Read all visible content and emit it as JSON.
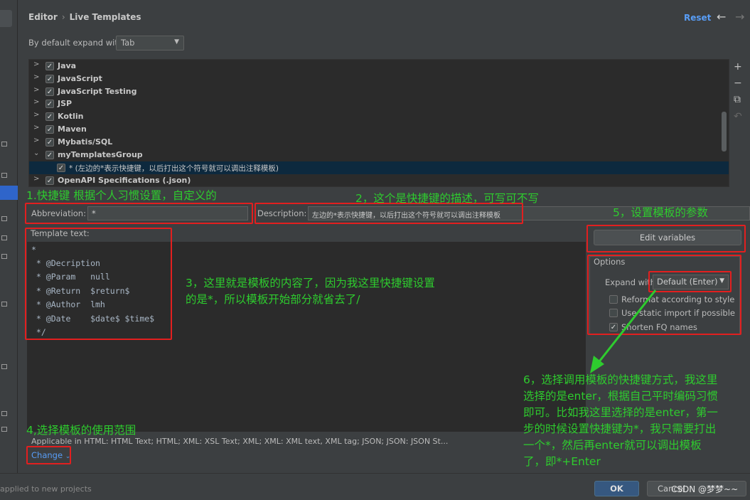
{
  "header": {
    "breadcrumb_parent": "Editor",
    "breadcrumb_current": "Live Templates",
    "reset": "Reset",
    "back_icon": "←",
    "forward_icon": "→"
  },
  "expand_default": {
    "label": "By default expand with",
    "value": "Tab"
  },
  "tree": {
    "items": [
      {
        "label": "Java"
      },
      {
        "label": "JavaScript"
      },
      {
        "label": "JavaScript Testing"
      },
      {
        "label": "JSP"
      },
      {
        "label": "Kotlin"
      },
      {
        "label": "Maven"
      },
      {
        "label": "Mybatis/SQL"
      },
      {
        "label": "myTemplatesGroup"
      },
      {
        "label": "* (左边的*表示快捷键，以后打出这个符号就可以调出注释模板)"
      },
      {
        "label": "OpenAPI Specifications (.json)"
      }
    ]
  },
  "toolbar": {
    "add": "+",
    "remove": "−",
    "copy": "⧉",
    "undo": "↶"
  },
  "abbreviation": {
    "label": "Abbreviation:",
    "value": "*"
  },
  "description": {
    "label": "Description:",
    "value": "左边的*表示快捷键，以后打出这个符号就可以调出注释模板"
  },
  "template": {
    "label": "Template text:",
    "lines": [
      "*",
      " * @Decription",
      " * @Param   null",
      " * @Return  $return$",
      " * @Author  lmh",
      " * @Date    $date$ $time$",
      " */"
    ]
  },
  "options": {
    "edit_variables": "Edit variables",
    "title": "Options",
    "expand_with_label": "Expand with",
    "expand_with_value": "Default (Enter)",
    "reformat": "Reformat according to style",
    "static_import": "Use static import if possible",
    "shorten_fq": "Shorten FQ names"
  },
  "applicable": "Applicable in HTML: HTML Text; HTML; XML: XSL Text; XML; XML: XML text, XML tag; JSON; JSON: JSON St...",
  "change": "Change",
  "footer": {
    "note": "applied to new projects",
    "ok": "OK",
    "cancel": "Cancel",
    "watermark": "CSDN @梦梦~~"
  },
  "annotations": {
    "a1": "1.快捷键 根据个人习惯设置，自定义的",
    "a2": "2，这个是快捷键的描述，可写可不写",
    "a3": "3，这里就是模板的内容了，因为我这里快捷键设置\n的是*，所以模板开始部分就省去了/",
    "a4": "4,选择模板的使用范围",
    "a5": "5，设置模板的参数",
    "a6": "6，选择调用模板的快捷键方式，我这里\n选择的是enter，根据自己平时编码习惯\n即可。比如我这里选择的是enter，第一\n步的时候设置快捷键为*，我只需要打出\n一个*，然后再enter就可以调出模板\n了，即*+Enter"
  }
}
